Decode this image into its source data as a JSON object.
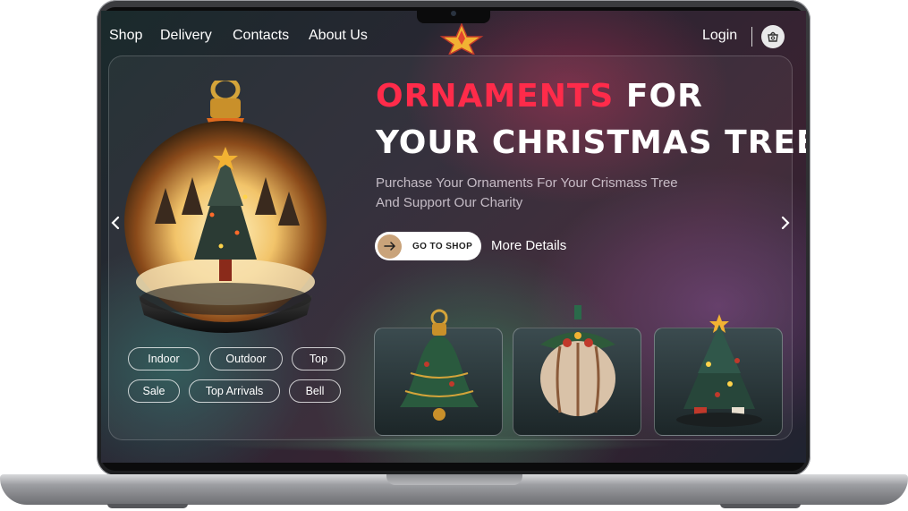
{
  "nav": {
    "links": [
      "Shop",
      "Delivery",
      "Contacts",
      "About Us"
    ],
    "login": "Login"
  },
  "hero": {
    "title_accent": "ORNAMENTS",
    "title_rest_line1": " FOR",
    "title_line2": "YOUR CHRISTMAS TREE",
    "subtitle_line1": "Purchase Your Ornaments For Your Crismass Tree",
    "subtitle_line2": "And Support Our Charity",
    "cta_label": "GO TO SHOP",
    "more_label": "More Details"
  },
  "categories": [
    "Indoor",
    "Outdoor",
    "Top",
    "Sale",
    "Top Arrivals",
    "Bell"
  ],
  "products": [
    "bell-ornament",
    "round-ball-ornament",
    "christmas-tree-ornament"
  ],
  "colors": {
    "accent_red": "#ff2b4a",
    "cta_arrow_bg": "#c9a37a",
    "text": "#ffffff"
  },
  "icons": [
    "star-icon",
    "basket-icon",
    "chevron-left-icon",
    "chevron-right-icon",
    "arrow-right-icon"
  ]
}
